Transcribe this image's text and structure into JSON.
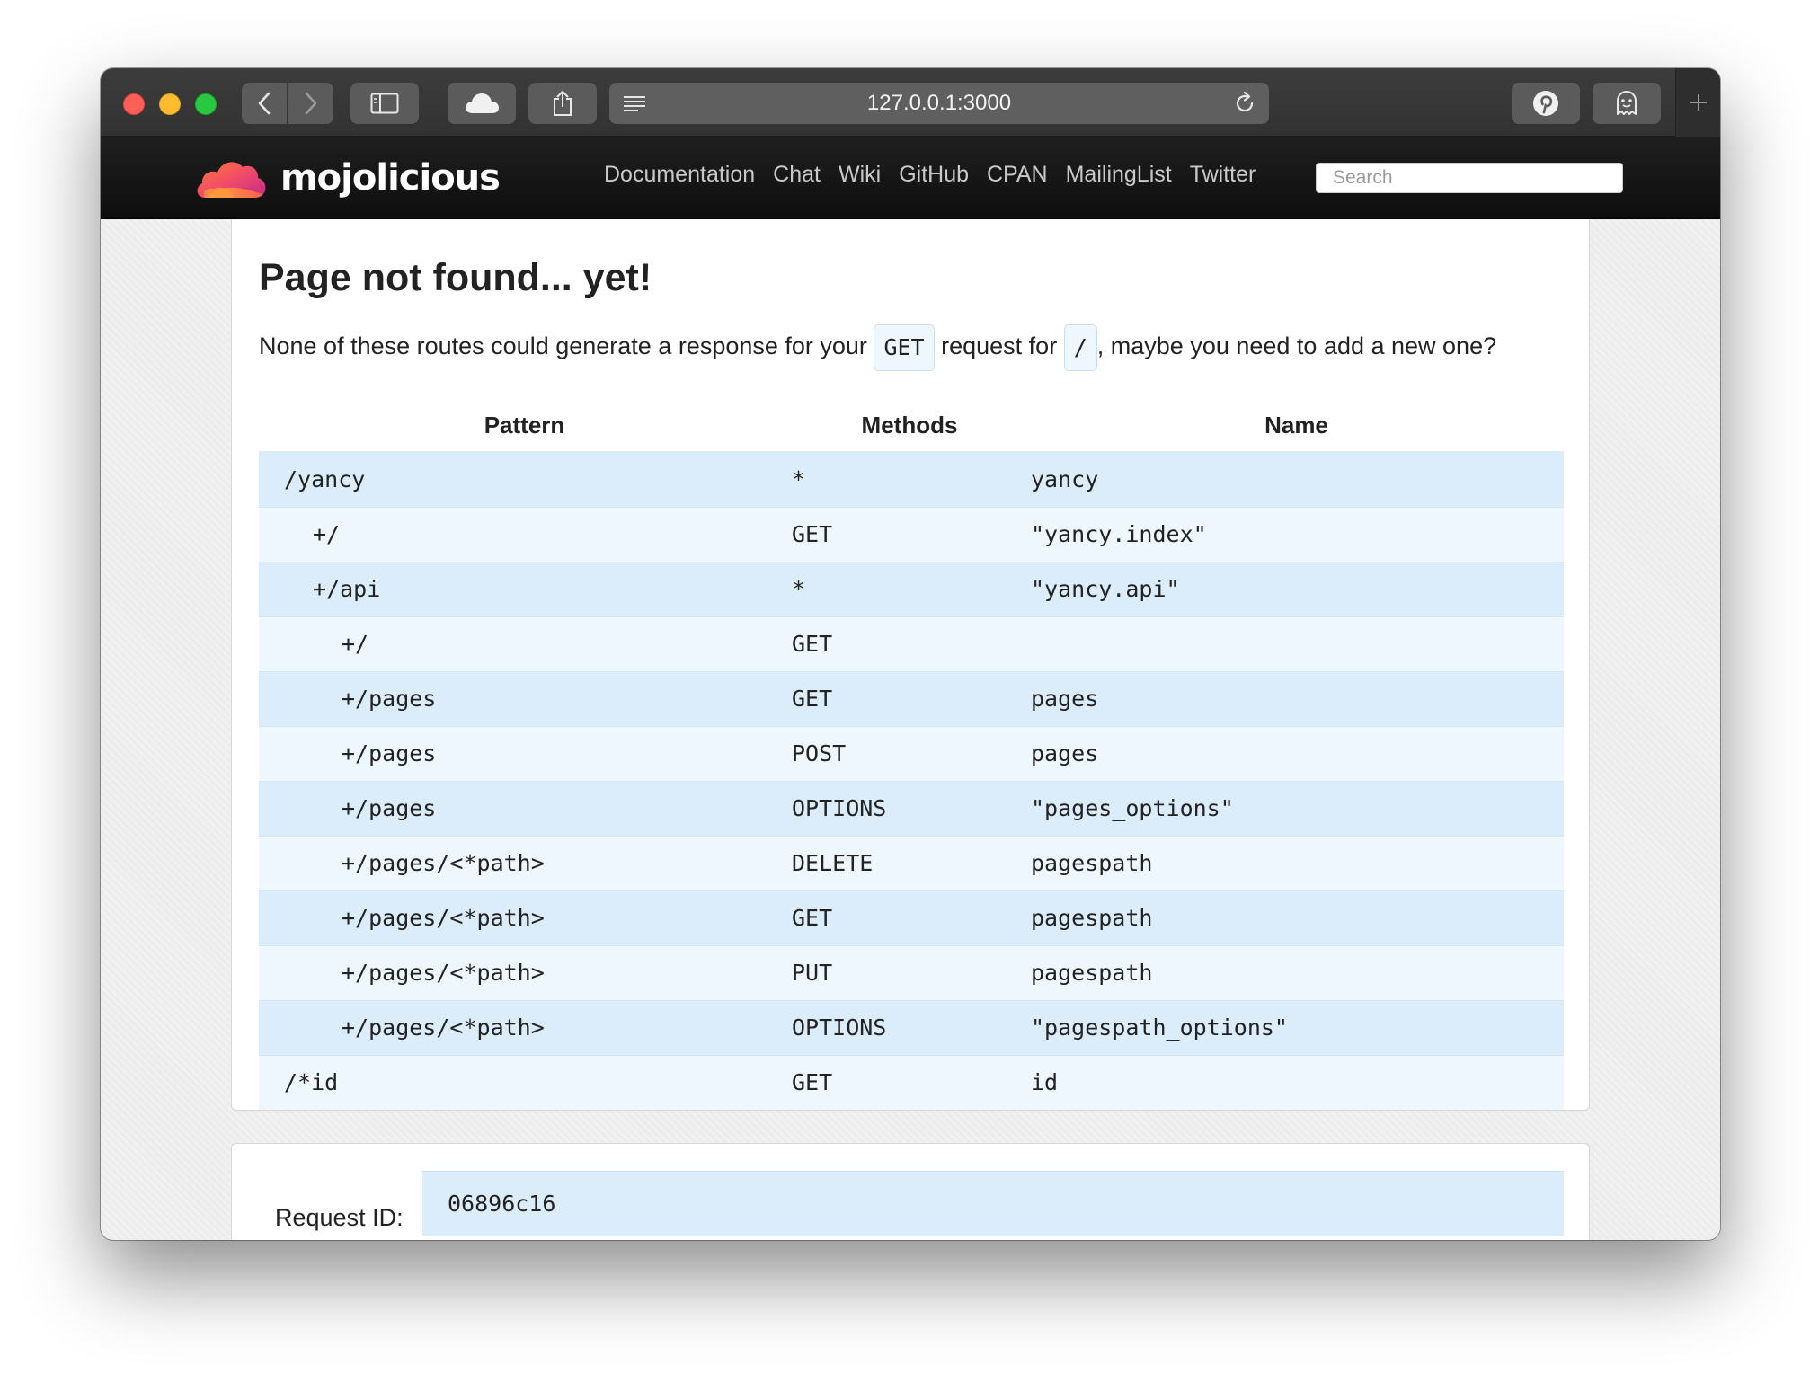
{
  "browser": {
    "url": "127.0.0.1:3000"
  },
  "site": {
    "logo_text": "mojolicious",
    "nav": [
      "Documentation",
      "Chat",
      "Wiki",
      "GitHub",
      "CPAN",
      "MailingList",
      "Twitter"
    ],
    "search_placeholder": "Search"
  },
  "page": {
    "title": "Page not found... yet!",
    "lead_before": "None of these routes could generate a response for your",
    "method_code": "GET",
    "lead_middle": "request for",
    "path_code": "/",
    "lead_after": ", maybe you need to add a new one?"
  },
  "routes_table": {
    "headers": [
      "Pattern",
      "Methods",
      "Name"
    ],
    "rows": [
      {
        "pattern": "/yancy",
        "methods": "*",
        "name": "yancy",
        "depth": 0
      },
      {
        "pattern": "+/",
        "methods": "GET",
        "name": "\"yancy.index\"",
        "depth": 1
      },
      {
        "pattern": "+/api",
        "methods": "*",
        "name": "\"yancy.api\"",
        "depth": 1
      },
      {
        "pattern": "+/",
        "methods": "GET",
        "name": "",
        "depth": 2
      },
      {
        "pattern": "+/pages",
        "methods": "GET",
        "name": "pages",
        "depth": 2
      },
      {
        "pattern": "+/pages",
        "methods": "POST",
        "name": "pages",
        "depth": 2
      },
      {
        "pattern": "+/pages",
        "methods": "OPTIONS",
        "name": "\"pages_options\"",
        "depth": 2
      },
      {
        "pattern": "+/pages/<*path>",
        "methods": "DELETE",
        "name": "pagespath",
        "depth": 2
      },
      {
        "pattern": "+/pages/<*path>",
        "methods": "GET",
        "name": "pagespath",
        "depth": 2
      },
      {
        "pattern": "+/pages/<*path>",
        "methods": "PUT",
        "name": "pagespath",
        "depth": 2
      },
      {
        "pattern": "+/pages/<*path>",
        "methods": "OPTIONS",
        "name": "\"pagespath_options\"",
        "depth": 2
      },
      {
        "pattern": "/*id",
        "methods": "GET",
        "name": "id",
        "depth": 0
      }
    ]
  },
  "request": {
    "label": "Request ID:",
    "id": "06896c16"
  },
  "colors": {
    "row_odd": "#dbecfb",
    "row_even": "#eef7fe",
    "header_bg": "#111111"
  }
}
